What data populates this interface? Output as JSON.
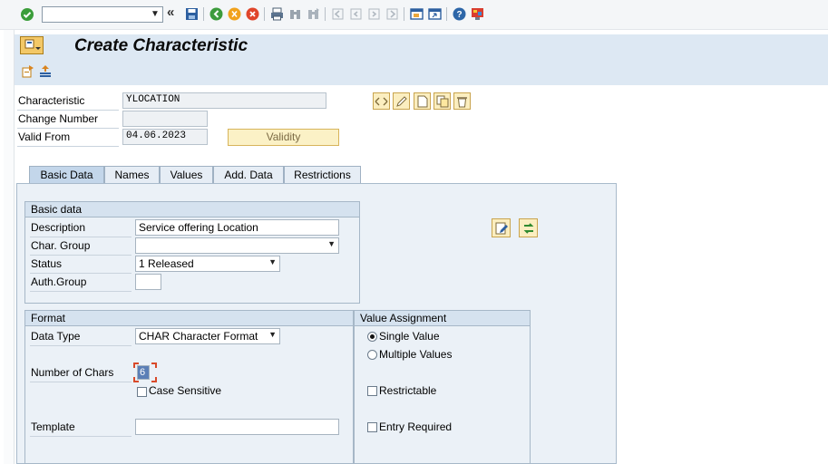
{
  "title": "Create Characteristic",
  "toolbar": {
    "command_field_value": "",
    "collapse_glyph": "«"
  },
  "header": {
    "characteristic_label": "Characteristic",
    "characteristic_value": "YLOCATION",
    "change_number_label": "Change Number",
    "change_number_value": "",
    "valid_from_label": "Valid From",
    "valid_from_value": "04.06.2023",
    "validity_button": "Validity"
  },
  "tabs": [
    {
      "label": "Basic Data",
      "active": true
    },
    {
      "label": "Names",
      "active": false
    },
    {
      "label": "Values",
      "active": false
    },
    {
      "label": "Add. Data",
      "active": false
    },
    {
      "label": "Restrictions",
      "active": false
    }
  ],
  "basic_data": {
    "heading": "Basic data",
    "description_label": "Description",
    "description_value": "Service offering Location",
    "char_group_label": "Char. Group",
    "char_group_value": "",
    "status_label": "Status",
    "status_value": "1 Released",
    "auth_group_label": "Auth.Group",
    "auth_group_value": ""
  },
  "format": {
    "heading": "Format",
    "data_type_label": "Data Type",
    "data_type_value": "CHAR Character Format",
    "num_chars_label": "Number of Chars",
    "num_chars_value": "6",
    "case_sensitive_label": "Case Sensitive",
    "case_sensitive_checked": false,
    "template_label": "Template",
    "template_value": ""
  },
  "value_assignment": {
    "heading": "Value Assignment",
    "single_value_label": "Single Value",
    "multiple_values_label": "Multiple Values",
    "selected": "single",
    "restrictable_label": "Restrictable",
    "entry_required_label": "Entry Required"
  },
  "icons": {
    "enter": "green-check-icon",
    "save": "save-icon",
    "back": "back-icon",
    "exit": "exit-icon",
    "cancel": "cancel-icon",
    "print": "print-icon",
    "find": "find-icon",
    "find_next": "find-next-icon",
    "help": "help-icon",
    "layout": "customize-layout-icon"
  },
  "colors": {
    "accent_green": "#2f9e44",
    "title_bg": "#dde8f3",
    "panel_bg": "#ebf1f7",
    "button_yellow": "#fbf1c6"
  }
}
